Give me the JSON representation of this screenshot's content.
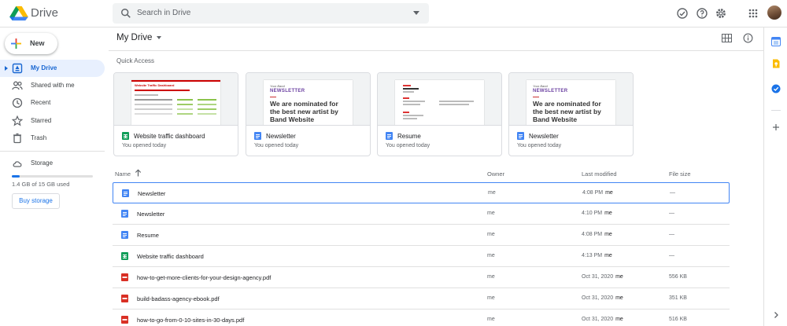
{
  "app": {
    "brand": "Drive"
  },
  "search": {
    "placeholder": "Search in Drive"
  },
  "sidebar": {
    "new_label": "New",
    "items": [
      {
        "label": "My Drive",
        "icon": "my-drive-icon",
        "active": true
      },
      {
        "label": "Shared with me",
        "icon": "shared-icon",
        "active": false
      },
      {
        "label": "Recent",
        "icon": "clock-icon",
        "active": false
      },
      {
        "label": "Starred",
        "icon": "star-icon",
        "active": false
      },
      {
        "label": "Trash",
        "icon": "trash-icon",
        "active": false
      }
    ],
    "storage": {
      "label": "Storage",
      "usage_text": "1.4 GB of 15 GB used",
      "used_fraction": 0.093,
      "buy_label": "Buy storage"
    }
  },
  "main": {
    "title": "My Drive",
    "quick_access": {
      "title": "Quick Access",
      "cards": [
        {
          "name": "Website traffic dashboard",
          "subtitle": "You opened today",
          "type": "sheets",
          "preview_title": "Website Traffic Dashboard"
        },
        {
          "name": "Newsletter",
          "subtitle": "You opened today",
          "type": "docs",
          "preview_kicker": "Your Band",
          "preview_title": "NEWSLETTER",
          "preview_body": "We are nominated for the best new artist by Band Website"
        },
        {
          "name": "Resume",
          "subtitle": "You opened today",
          "type": "docs"
        },
        {
          "name": "Newsletter",
          "subtitle": "You opened today",
          "type": "docs",
          "preview_kicker": "Your Band",
          "preview_title": "NEWSLETTER",
          "preview_body": "We are nominated for the best new artist by Band Website"
        }
      ]
    },
    "table": {
      "headers": {
        "name": "Name",
        "owner": "Owner",
        "modified": "Last modified",
        "size": "File size"
      },
      "rows": [
        {
          "name": "Newsletter",
          "type": "docs",
          "owner": "me",
          "modified": "4:08 PM",
          "modified_by": "me",
          "size": "—",
          "selected": true
        },
        {
          "name": "Newsletter",
          "type": "docs",
          "owner": "me",
          "modified": "4:10 PM",
          "modified_by": "me",
          "size": "—",
          "selected": false
        },
        {
          "name": "Resume",
          "type": "docs",
          "owner": "me",
          "modified": "4:08 PM",
          "modified_by": "me",
          "size": "—",
          "selected": false
        },
        {
          "name": "Website traffic dashboard",
          "type": "sheets",
          "owner": "me",
          "modified": "4:13 PM",
          "modified_by": "me",
          "size": "—",
          "selected": false
        },
        {
          "name": "how-to-get-more-clients-for-your-design-agency.pdf",
          "type": "pdf",
          "owner": "me",
          "modified": "Oct 31, 2020",
          "modified_by": "me",
          "size": "556 KB",
          "selected": false
        },
        {
          "name": "build-badass-agency-ebook.pdf",
          "type": "pdf",
          "owner": "me",
          "modified": "Oct 31, 2020",
          "modified_by": "me",
          "size": "351 KB",
          "selected": false
        },
        {
          "name": "how-to-go-from-0-10-sites-in-30-days.pdf",
          "type": "pdf",
          "owner": "me",
          "modified": "Oct 31, 2020",
          "modified_by": "me",
          "size": "516 KB",
          "selected": false
        }
      ]
    }
  },
  "colors": {
    "accent": "#1a73e8",
    "docs": "#4285f4",
    "sheets": "#0f9d58",
    "pdf": "#d93025",
    "active_nav_bg": "#e8f0fe"
  }
}
